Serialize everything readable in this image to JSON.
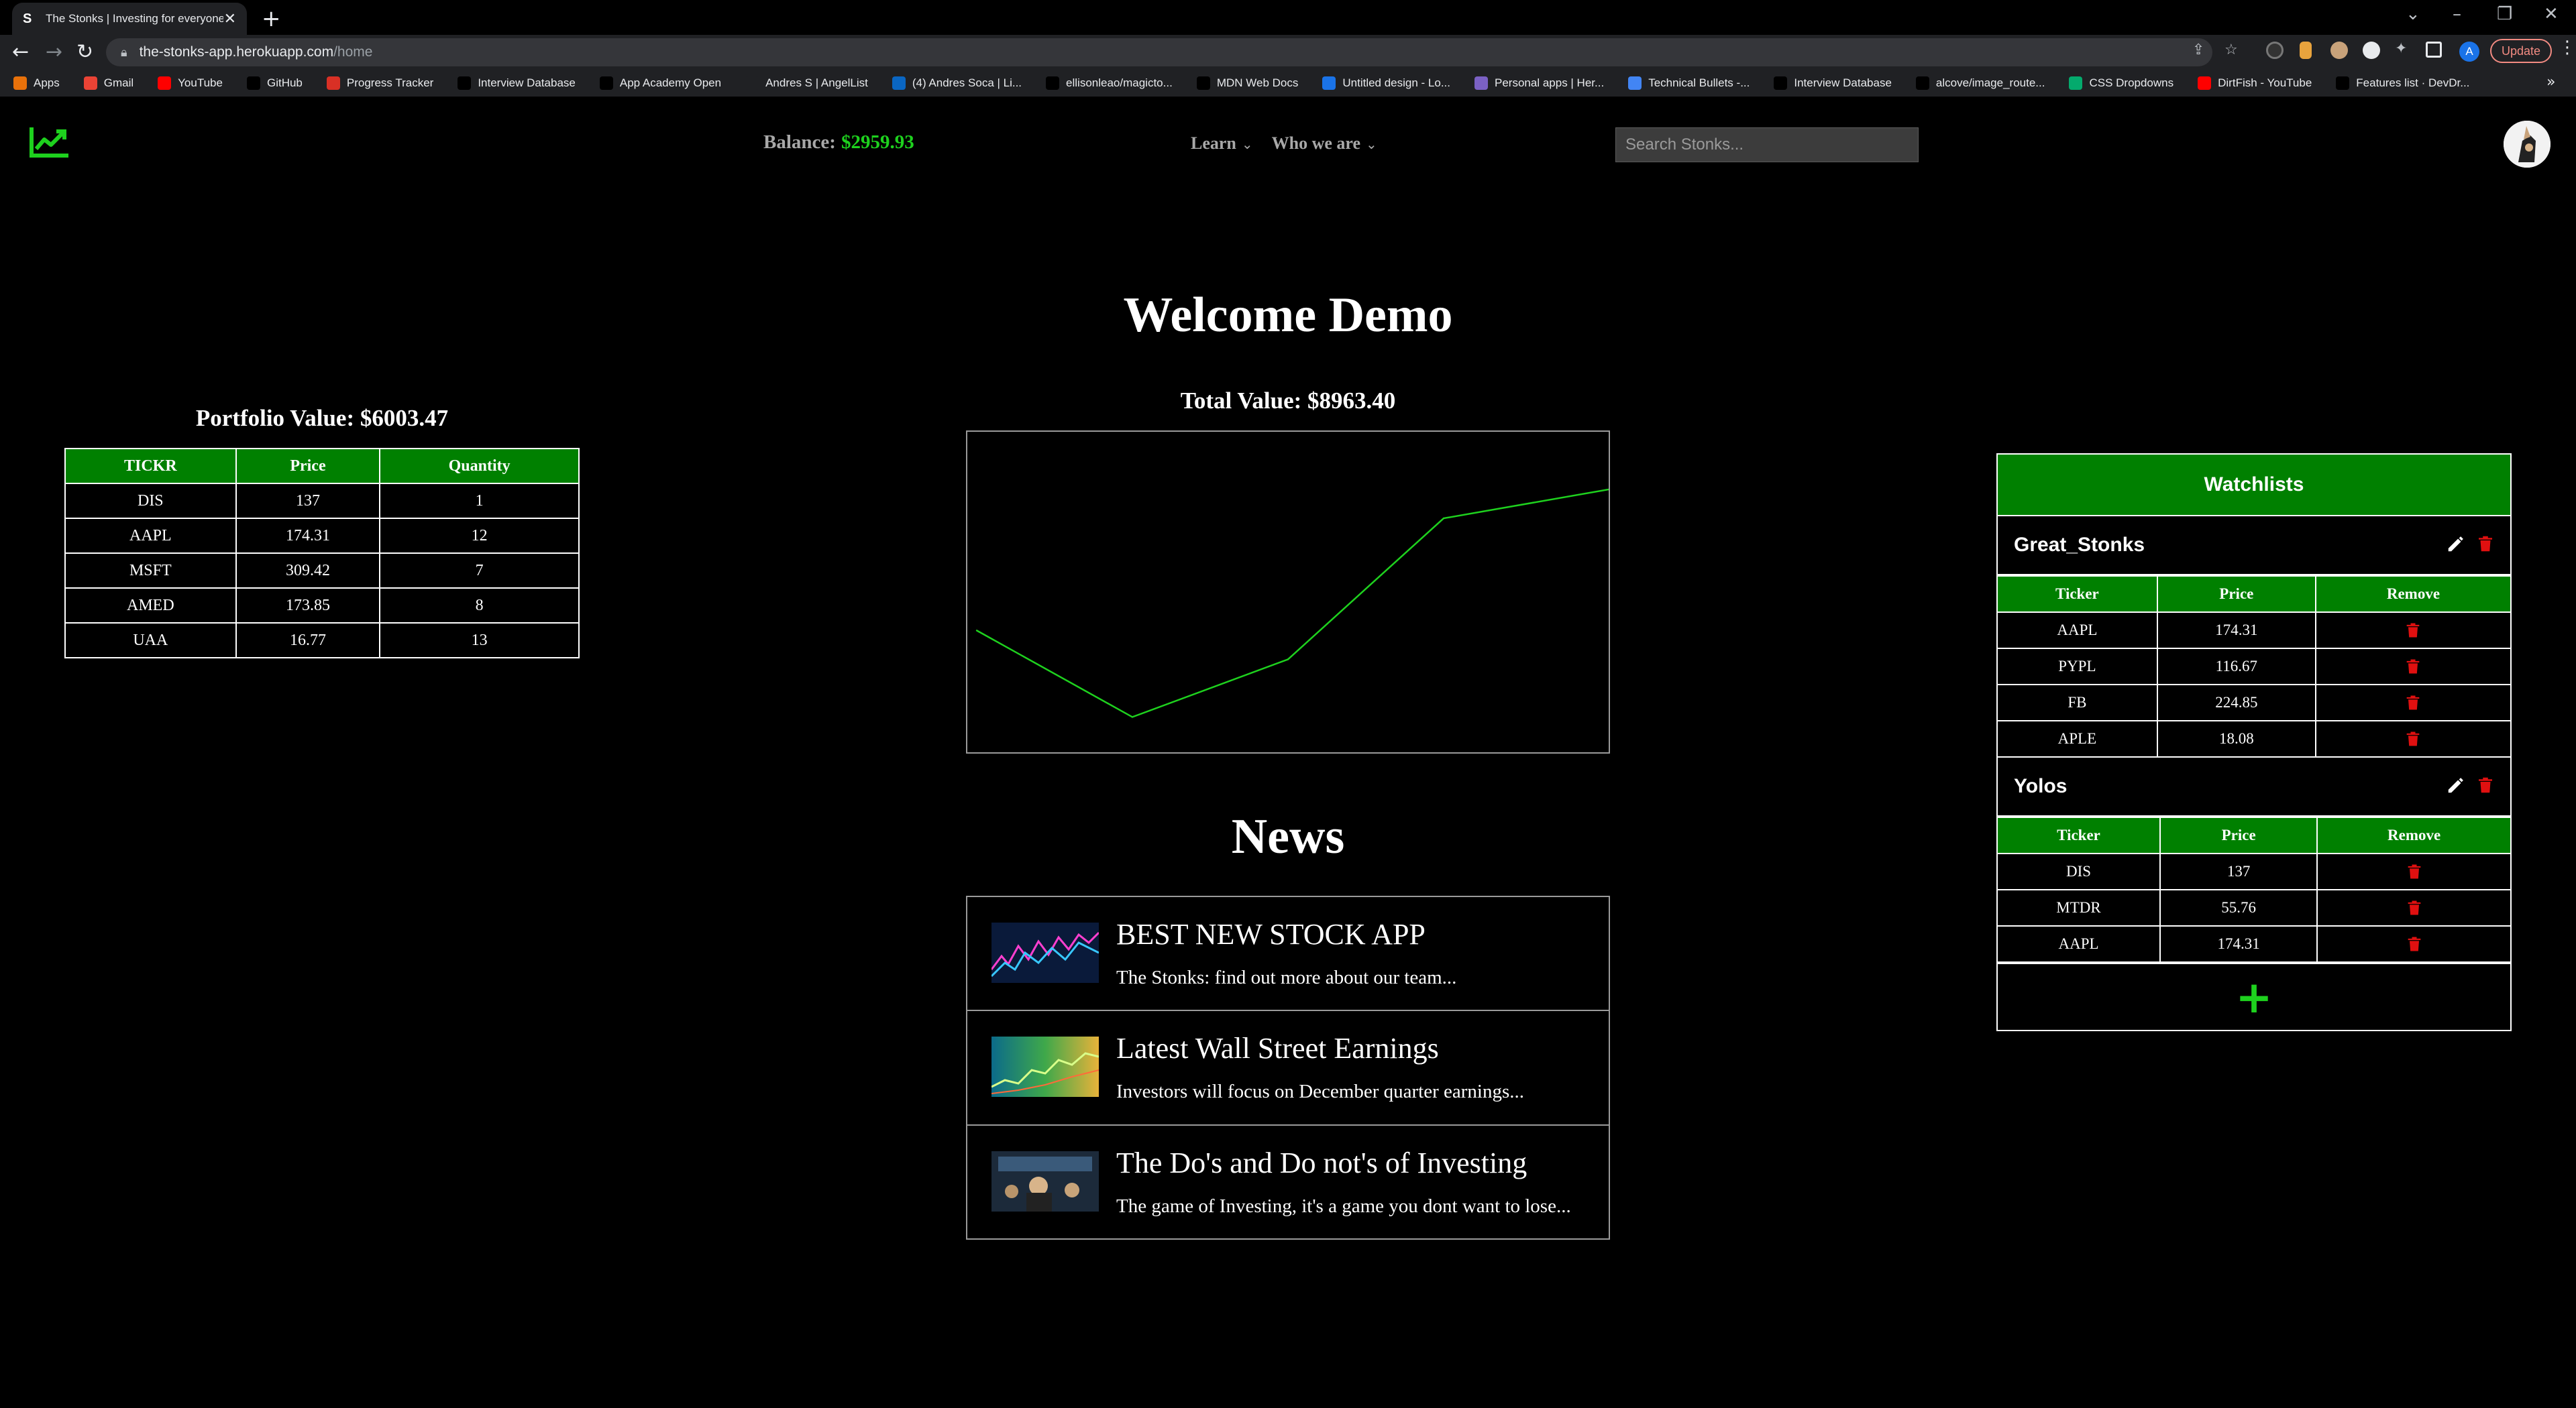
{
  "browser": {
    "tab_favicon": "S",
    "tab_title": "The Stonks | Investing for everyone",
    "url_host": "the-stonks-app.herokuapp.com",
    "url_path": "/home",
    "update_label": "Update",
    "profile_initial": "A",
    "bookmarks": [
      {
        "label": "Apps",
        "icon": "apps-grid-icon",
        "color": "#e8710a"
      },
      {
        "label": "Gmail",
        "icon": "gmail-icon",
        "color": "#ea4335"
      },
      {
        "label": "YouTube",
        "icon": "youtube-icon",
        "color": "#ff0000"
      },
      {
        "label": "GitHub",
        "icon": "github-icon",
        "color": "#000000"
      },
      {
        "label": "Progress Tracker",
        "icon": "progress-tracker-icon",
        "color": "#d93025"
      },
      {
        "label": "Interview Database",
        "icon": "interview-db-icon",
        "color": "#000000"
      },
      {
        "label": "App Academy Open",
        "icon": "app-academy-icon",
        "color": "#000000"
      },
      {
        "label": "Andres S | AngelList",
        "icon": "angellist-icon",
        "color": "#202124"
      },
      {
        "label": "(4) Andres Soca | Li...",
        "icon": "linkedin-icon",
        "color": "#0a66c2"
      },
      {
        "label": "ellisonleao/magicto...",
        "icon": "github-icon",
        "color": "#000000"
      },
      {
        "label": "MDN Web Docs",
        "icon": "mdn-icon",
        "color": "#000000"
      },
      {
        "label": "Untitled design - Lo...",
        "icon": "canva-icon",
        "color": "#1a73e8"
      },
      {
        "label": "Personal apps | Her...",
        "icon": "heroku-icon",
        "color": "#7b61c4"
      },
      {
        "label": "Technical Bullets -...",
        "icon": "google-docs-icon",
        "color": "#4285f4"
      },
      {
        "label": "Interview Database",
        "icon": "interview-db-icon",
        "color": "#000000"
      },
      {
        "label": "alcove/image_route...",
        "icon": "github-icon",
        "color": "#000000"
      },
      {
        "label": "CSS Dropdowns",
        "icon": "w3schools-icon",
        "color": "#04aa6d"
      },
      {
        "label": "DirtFish - YouTube",
        "icon": "youtube-icon",
        "color": "#ff0000"
      },
      {
        "label": "Features list · DevDr...",
        "icon": "devdocs-icon",
        "color": "#000000"
      }
    ]
  },
  "nav": {
    "balance_label": "Balance:",
    "balance_value": "$2959.93",
    "learn_label": "Learn",
    "who_label": "Who we are",
    "search_placeholder": "Search Stonks..."
  },
  "main": {
    "welcome": "Welcome Demo",
    "total_value": "Total Value: $8963.40",
    "news_title": "News"
  },
  "portfolio": {
    "title": "Portfolio Value: $6003.47",
    "headers": [
      "TICKR",
      "Price",
      "Quantity"
    ],
    "rows": [
      [
        "DIS",
        "137",
        "1"
      ],
      [
        "AAPL",
        "174.31",
        "12"
      ],
      [
        "MSFT",
        "309.42",
        "7"
      ],
      [
        "AMED",
        "173.85",
        "8"
      ],
      [
        "UAA",
        "16.77",
        "13"
      ]
    ]
  },
  "chart_data": {
    "type": "line",
    "title": "",
    "xlabel": "",
    "ylabel": "",
    "grid": false,
    "series": [
      {
        "values": [
          0.62,
          0.89,
          0.71,
          0.27,
          0.18
        ],
        "color": "#1ed11e"
      }
    ]
  },
  "news": [
    {
      "headline": "BEST NEW STOCK APP",
      "summary": "The Stonks: find out more about our team..."
    },
    {
      "headline": "Latest Wall Street Earnings",
      "summary": "Investors will focus on December quarter earnings..."
    },
    {
      "headline": "The Do's and Do not's of Investing",
      "summary": "The game of Investing, it's a game you dont want to lose..."
    }
  ],
  "watchlists": {
    "header": "Watchlists",
    "columns": [
      "Ticker",
      "Price",
      "Remove"
    ],
    "lists": [
      {
        "name": "Great_Stonks",
        "rows": [
          [
            "AAPL",
            "174.31"
          ],
          [
            "PYPL",
            "116.67"
          ],
          [
            "FB",
            "224.85"
          ],
          [
            "APLE",
            "18.08"
          ]
        ]
      },
      {
        "name": "Yolos",
        "rows": [
          [
            "DIS",
            "137"
          ],
          [
            "MTDR",
            "55.76"
          ],
          [
            "AAPL",
            "174.31"
          ]
        ]
      }
    ],
    "add_symbol": "+"
  },
  "colors": {
    "accent_green": "#008000",
    "balance_green": "#1ed11e",
    "trash_red": "#e01010"
  }
}
